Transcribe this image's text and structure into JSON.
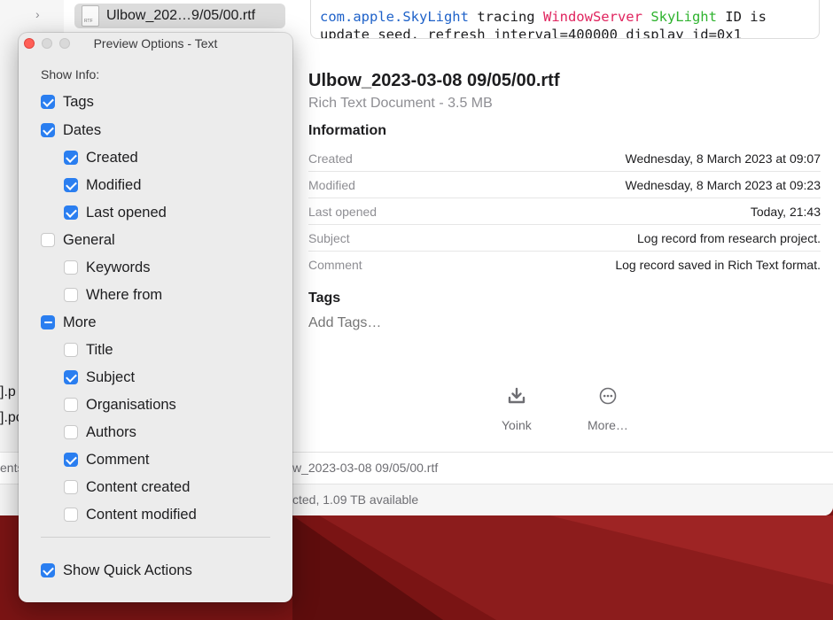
{
  "finder": {
    "selected_file": "Ulbow_202…9/05/00.rtf",
    "code_preview": {
      "line1_parts": [
        "com.apple.SkyLight",
        " tracing ",
        "WindowServer",
        " ",
        "SkyLight",
        " ID is"
      ],
      "line2": "update seed. refresh_interval=400000 display_id=0x1"
    },
    "preview": {
      "title": "Ulbow_2023-03-08 09/05/00.rtf",
      "subtitle": "Rich Text Document - 3.5 MB",
      "information_heading": "Information",
      "info_rows": [
        {
          "key": "Created",
          "value": "Wednesday, 8 March 2023 at 09:07"
        },
        {
          "key": "Modified",
          "value": "Wednesday, 8 March 2023 at 09:23"
        },
        {
          "key": "Last opened",
          "value": "Today, 21:43"
        },
        {
          "key": "Subject",
          "value": "Log record from research project."
        },
        {
          "key": "Comment",
          "value": "Log record saved in Rich Text format."
        }
      ],
      "tags_heading": "Tags",
      "tags_placeholder": "Add Tags…",
      "quick_actions": [
        {
          "label": "Yoink",
          "icon": "download-tray-icon"
        },
        {
          "label": "More…",
          "icon": "ellipsis-circle-icon"
        }
      ]
    },
    "path_bar_text": "w_2023-03-08 09/05/00.rtf",
    "path_bar_left_fragment": "ents",
    "status_text": "cted, 1.09 TB available",
    "sidebar_fragments": [
      "].p",
      "].pc"
    ]
  },
  "panel": {
    "title": "Preview Options - Text",
    "show_info_label": "Show Info:",
    "options": {
      "tags": {
        "label": "Tags",
        "state": "on"
      },
      "dates": {
        "label": "Dates",
        "state": "on"
      },
      "created": {
        "label": "Created",
        "state": "on"
      },
      "modified": {
        "label": "Modified",
        "state": "on"
      },
      "last_opened": {
        "label": "Last opened",
        "state": "on"
      },
      "general": {
        "label": "General",
        "state": "off"
      },
      "keywords": {
        "label": "Keywords",
        "state": "off"
      },
      "where_from": {
        "label": "Where from",
        "state": "off"
      },
      "more": {
        "label": "More",
        "state": "mixed"
      },
      "title_opt": {
        "label": "Title",
        "state": "off"
      },
      "subject": {
        "label": "Subject",
        "state": "on"
      },
      "organisations": {
        "label": "Organisations",
        "state": "off"
      },
      "authors": {
        "label": "Authors",
        "state": "off"
      },
      "comment": {
        "label": "Comment",
        "state": "on"
      },
      "content_created": {
        "label": "Content created",
        "state": "off"
      },
      "content_modified": {
        "label": "Content modified",
        "state": "off"
      },
      "show_quick_actions": {
        "label": "Show Quick Actions",
        "state": "on"
      }
    }
  },
  "colors": {
    "accent": "#2a7ef0",
    "desktop": "#7a1414",
    "close_light": "#ff5f57"
  }
}
